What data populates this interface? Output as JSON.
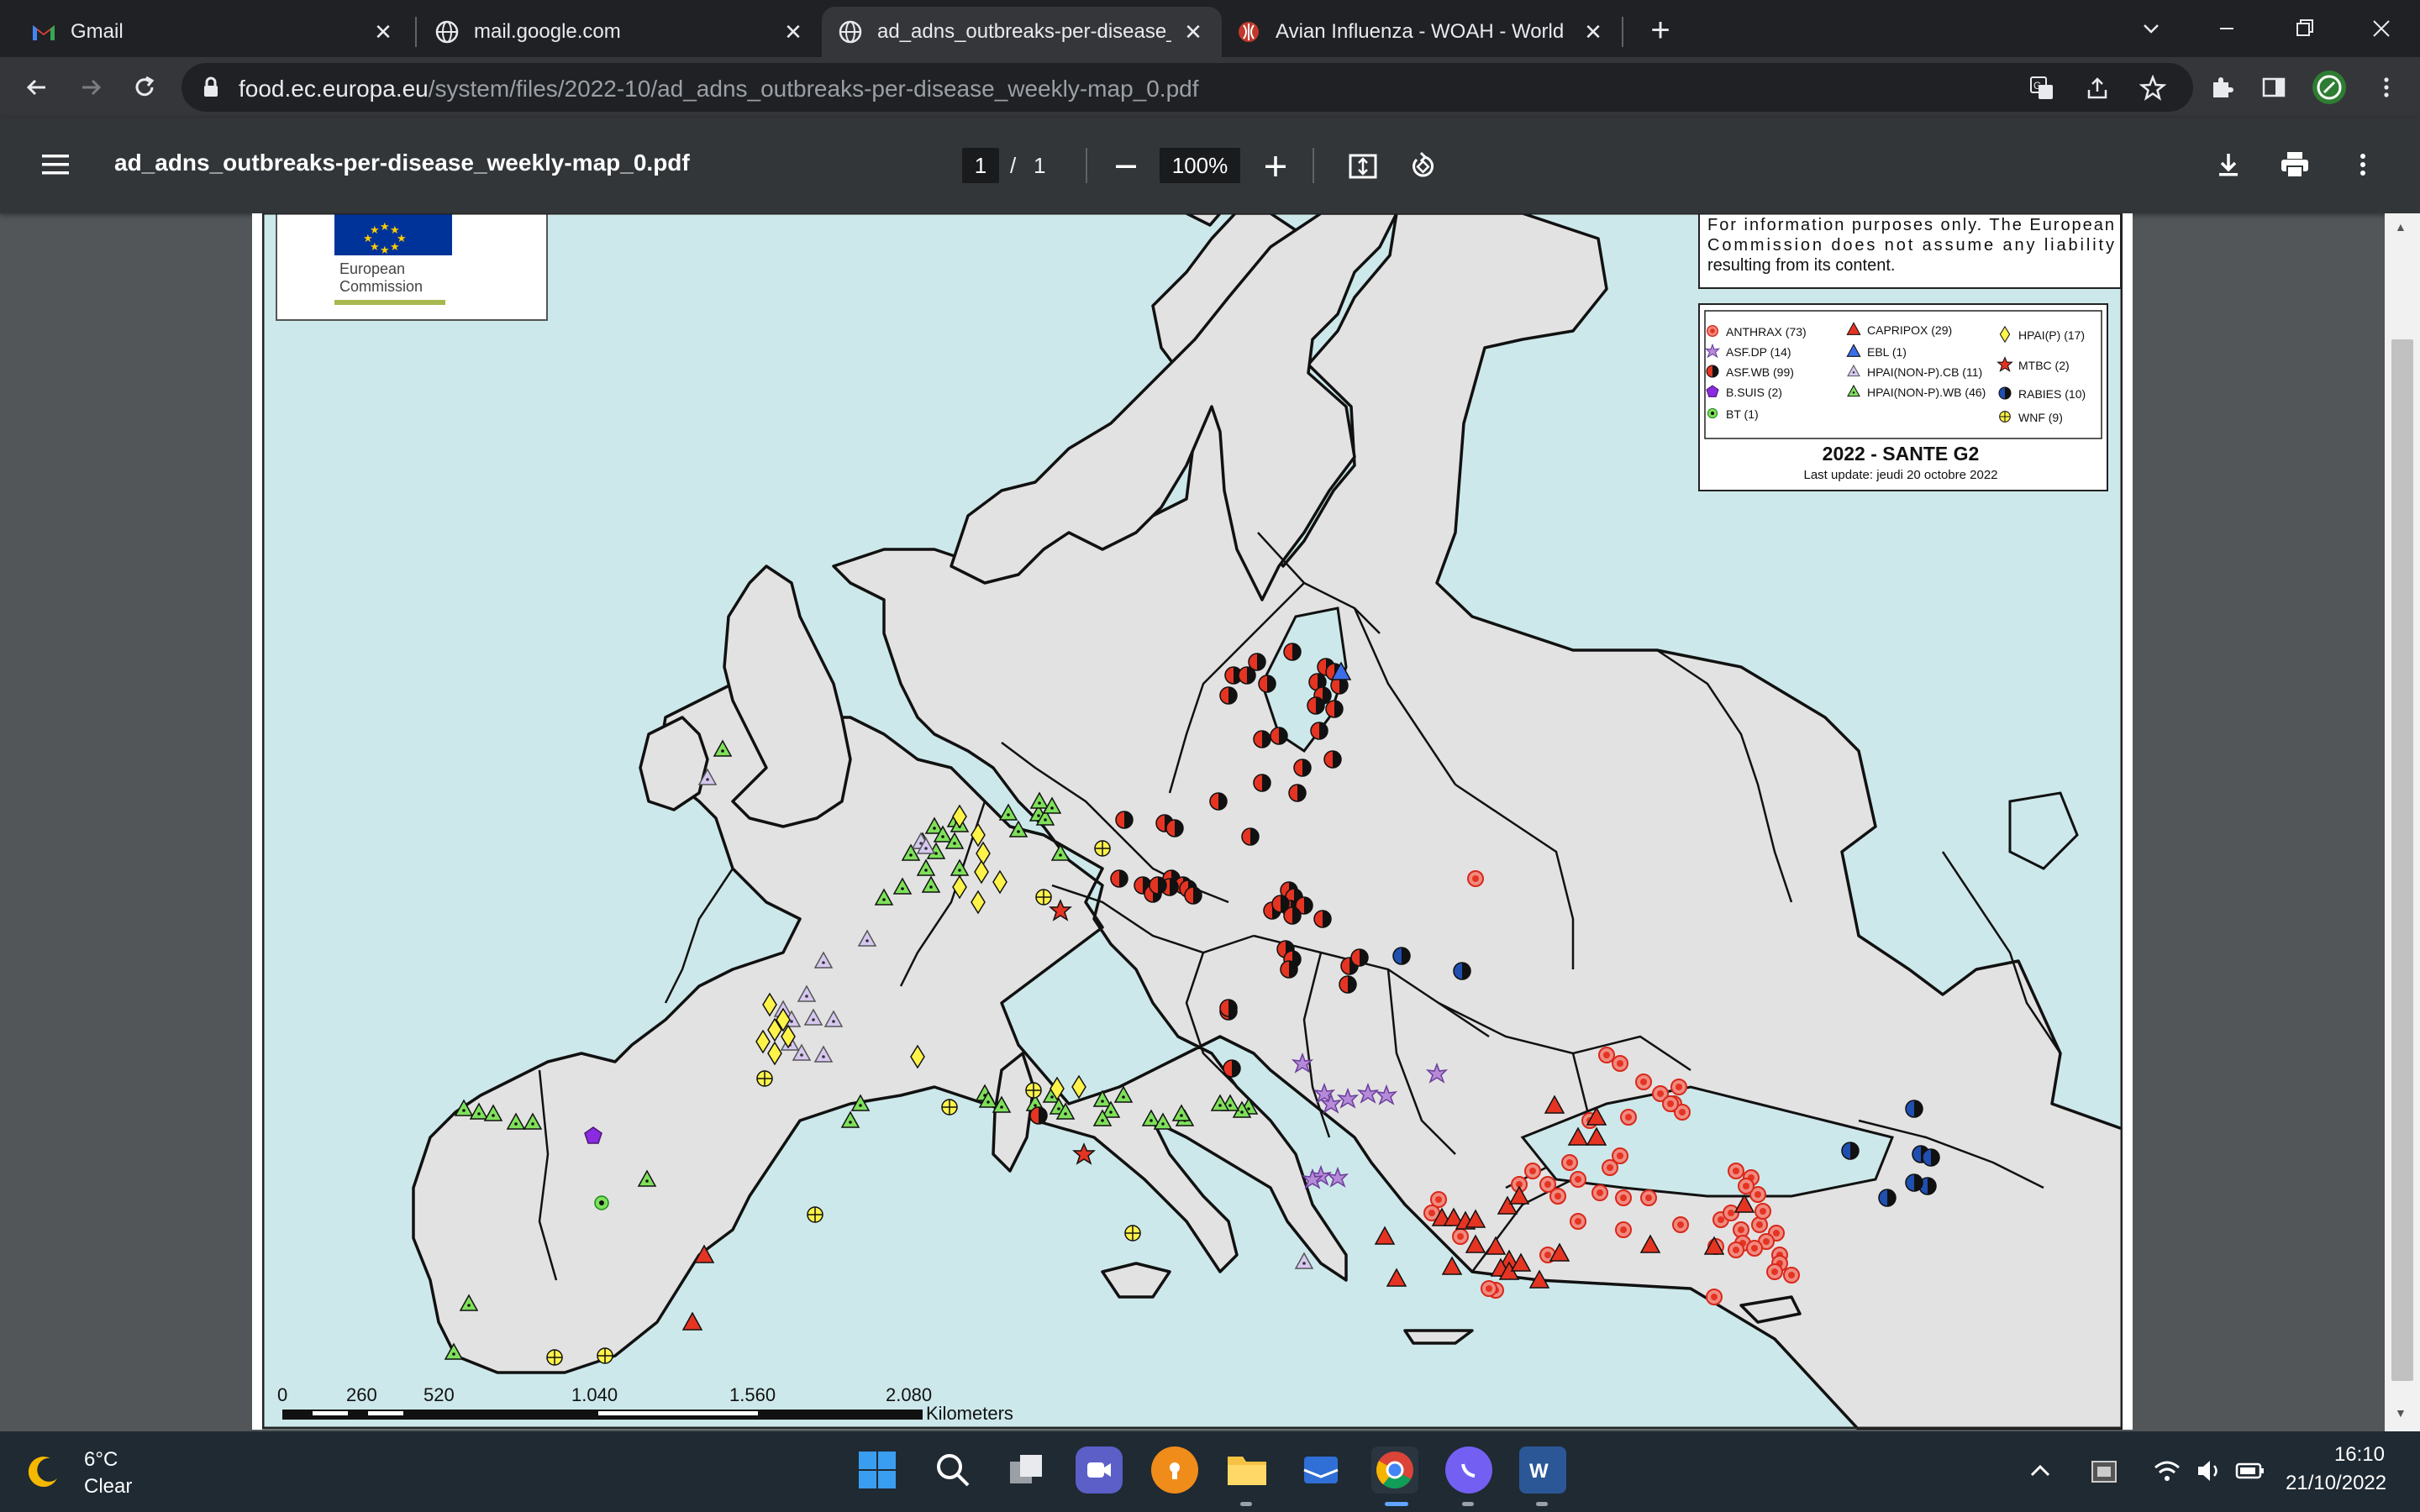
{
  "tabs": [
    {
      "title": "Gmail",
      "icon": "gmail-icon"
    },
    {
      "title": "mail.google.com",
      "icon": "globe-icon"
    },
    {
      "title": "ad_adns_outbreaks-per-disease_w",
      "icon": "globe-icon"
    },
    {
      "title": "Avian Influenza - WOAH - World",
      "icon": "woah-icon"
    }
  ],
  "omnibox": {
    "domain": "food.ec.europa.eu",
    "path": "/system/files/2022-10/ad_adns_outbreaks-per-disease_weekly-map_0.pdf"
  },
  "pdf": {
    "filename": "ad_adns_outbreaks-per-disease_weekly-map_0.pdf",
    "page_current": "1",
    "page_sep": "/",
    "page_total": "1",
    "zoom": "100%"
  },
  "map": {
    "logo_text_1": "European",
    "logo_text_2": "Commission",
    "disclaimer_1": "For information purposes only. The European",
    "disclaimer_2": "Commission does not assume any liability",
    "disclaimer_3": "resulting from its content.",
    "legend": [
      {
        "label": "ANTHRAX (73)",
        "symbol": "red-circle"
      },
      {
        "label": "ASF.DP (14)",
        "symbol": "purple-star"
      },
      {
        "label": "ASF.WB (99)",
        "symbol": "half-red-black"
      },
      {
        "label": "B.SUIS (2)",
        "symbol": "purple-pentagon"
      },
      {
        "label": "BT (1)",
        "symbol": "green-circle"
      },
      {
        "label": "CAPRIPOX (29)",
        "symbol": "red-triangle"
      },
      {
        "label": "EBL (1)",
        "symbol": "blue-triangle"
      },
      {
        "label": "HPAI(NON-P).CB (11)",
        "symbol": "lilac-triangle"
      },
      {
        "label": "HPAI(NON-P).WB (46)",
        "symbol": "green-triangle"
      },
      {
        "label": "HPAI(P) (17)",
        "symbol": "yellow-diamond"
      },
      {
        "label": "MTBC (2)",
        "symbol": "red-star"
      },
      {
        "label": "RABIES (10)",
        "symbol": "half-blue-black"
      },
      {
        "label": "WNF (9)",
        "symbol": "yellow-crosshair"
      }
    ],
    "legend_title": "2022 - SANTE G2",
    "legend_update": "Last update: jeudi 20 octobre 2022",
    "scale_ticks": [
      "0",
      "260",
      "520",
      "1.040",
      "1.560",
      "2.080"
    ],
    "scale_unit": "Kilometers"
  },
  "taskbar": {
    "temperature": "6°C",
    "weather": "Clear",
    "time": "16:10",
    "date": "21/10/2022"
  },
  "colors": {
    "chrome_dark": "#202124",
    "chrome_tab": "#35363a",
    "pdf_bar": "#323639",
    "sea": "#cde8ea",
    "land": "#e2e2e2",
    "taskbar": "#1f2a33"
  }
}
